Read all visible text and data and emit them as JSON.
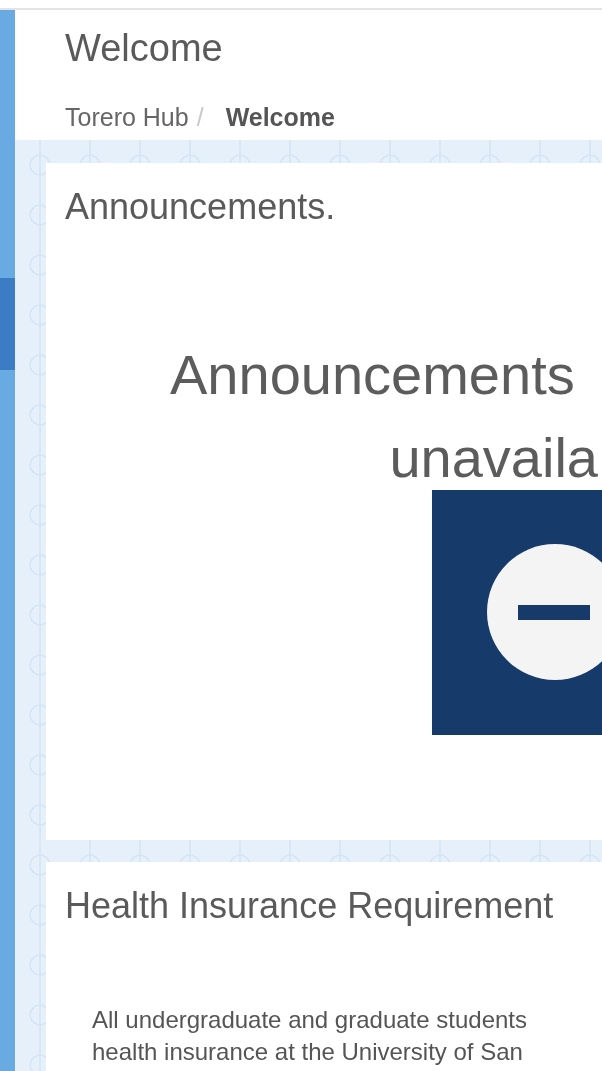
{
  "sidebar": {
    "items": [
      {
        "selected": false
      },
      {
        "selected": true
      },
      {
        "selected": false
      }
    ]
  },
  "header": {
    "title": "Welcome",
    "breadcrumb": [
      {
        "label": "Torero Hub",
        "current": false
      },
      {
        "label": "Welcome",
        "current": true
      }
    ],
    "separator": "/"
  },
  "announcements": {
    "title": "Announcements.",
    "message_lines": [
      "Announcements",
      "unavaila"
    ]
  },
  "health": {
    "title": "Health Insurance Requirement",
    "body_lines": [
      "All undergraduate and graduate students",
      "health insurance at the University of San"
    ]
  }
}
